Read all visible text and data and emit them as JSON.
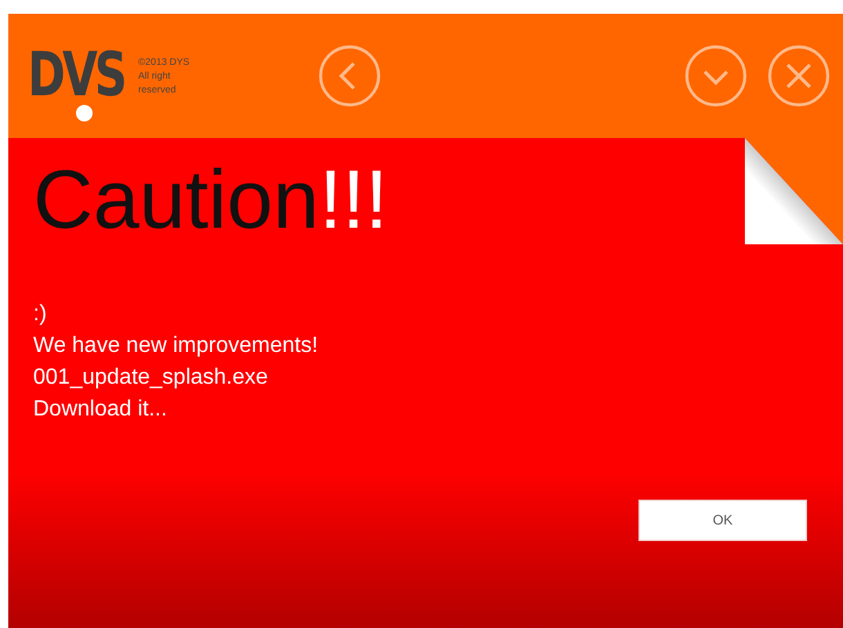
{
  "logo": {
    "text": "DVS",
    "copyright": [
      "©2013 DYS",
      "All right",
      "reserved"
    ]
  },
  "heading": {
    "text": "Caution",
    "emphasis": "!!!"
  },
  "message": [
    ":)",
    "We have new improvements!",
    "001_update_splash.exe",
    "Download it..."
  ],
  "buttons": [
    "OK"
  ]
}
